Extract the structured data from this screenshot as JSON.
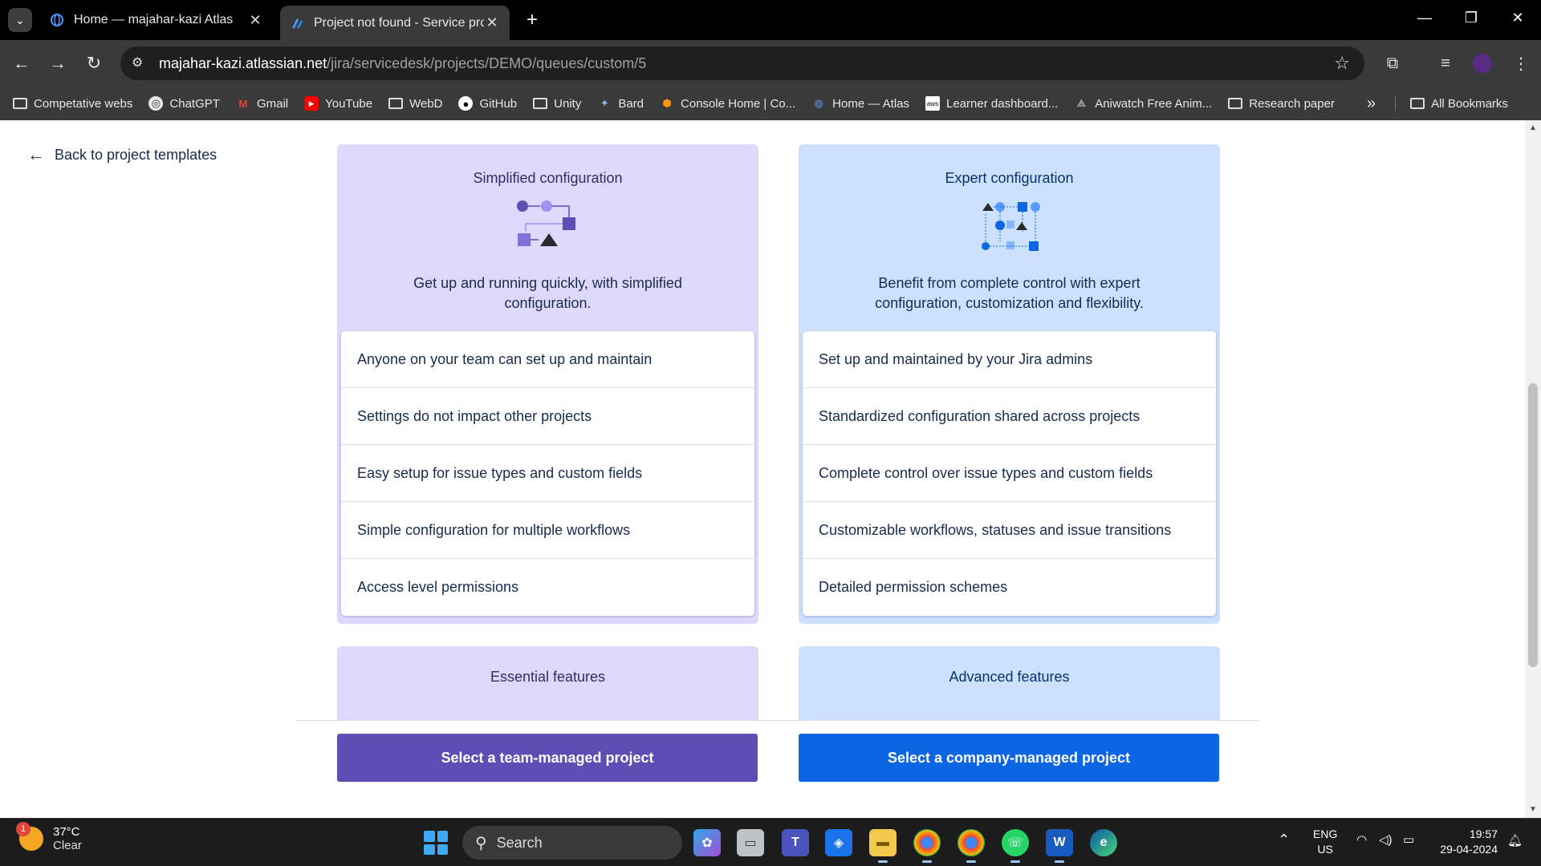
{
  "browser": {
    "tabs": [
      {
        "title": "Home — majahar-kazi Atlas",
        "active": false
      },
      {
        "title": "Project not found - Service proj",
        "active": true
      }
    ],
    "url_host": "majahar-kazi.atlassian.net",
    "url_path": "/jira/servicedesk/projects/DEMO/queues/custom/5",
    "bookmarks": [
      {
        "label": "Competative webs",
        "icon": "folder-icon"
      },
      {
        "label": "ChatGPT",
        "icon": "chatgpt-icon"
      },
      {
        "label": "Gmail",
        "icon": "gmail-icon"
      },
      {
        "label": "YouTube",
        "icon": "youtube-icon"
      },
      {
        "label": "WebD",
        "icon": "folder-icon"
      },
      {
        "label": "GitHub",
        "icon": "github-icon"
      },
      {
        "label": "Unity",
        "icon": "folder-icon"
      },
      {
        "label": "Bard",
        "icon": "bard-icon"
      },
      {
        "label": "Console Home | Co...",
        "icon": "aws-icon"
      },
      {
        "label": "Home — Atlas",
        "icon": "atlas-icon"
      },
      {
        "label": "Learner dashboard...",
        "icon": "aws-icon"
      },
      {
        "label": "Aniwatch Free Anim...",
        "icon": "aniwatch-icon"
      },
      {
        "label": "Research paper",
        "icon": "folder-icon"
      }
    ],
    "all_bookmarks": "All Bookmarks",
    "overflow": "»"
  },
  "page": {
    "back_label": "Back to project templates",
    "cards": [
      {
        "title": "Simplified configuration",
        "description": "Get up and running quickly, with simplified configuration.",
        "items": [
          "Anyone on your team can set up and maintain",
          "Settings do not impact other projects",
          "Easy setup for issue types and custom fields",
          "Simple configuration for multiple workflows",
          "Access level permissions"
        ]
      },
      {
        "title": "Expert configuration",
        "description": "Benefit from complete control with expert configuration, customization and flexibility.",
        "items": [
          "Set up and maintained by your Jira admins",
          "Standardized configuration shared across projects",
          "Complete control over issue types and custom fields",
          "Customizable workflows, statuses and issue transitions",
          "Detailed permission schemes"
        ]
      }
    ],
    "feature_cards": [
      "Essential features",
      "Advanced features"
    ],
    "buttons": {
      "team_managed": "Select a team-managed project",
      "company_managed": "Select a company-managed project"
    },
    "colors": {
      "purple_card": "#dfd8fd",
      "blue_card": "#cce0ff",
      "purple_button": "#5e4db2",
      "blue_button": "#0c66e4"
    }
  },
  "taskbar": {
    "temperature": "37°C",
    "condition": "Clear",
    "weather_badge": "1",
    "search_label": "Search",
    "lang": "ENG",
    "region": "US",
    "time": "19:57",
    "date": "29-04-2024"
  }
}
